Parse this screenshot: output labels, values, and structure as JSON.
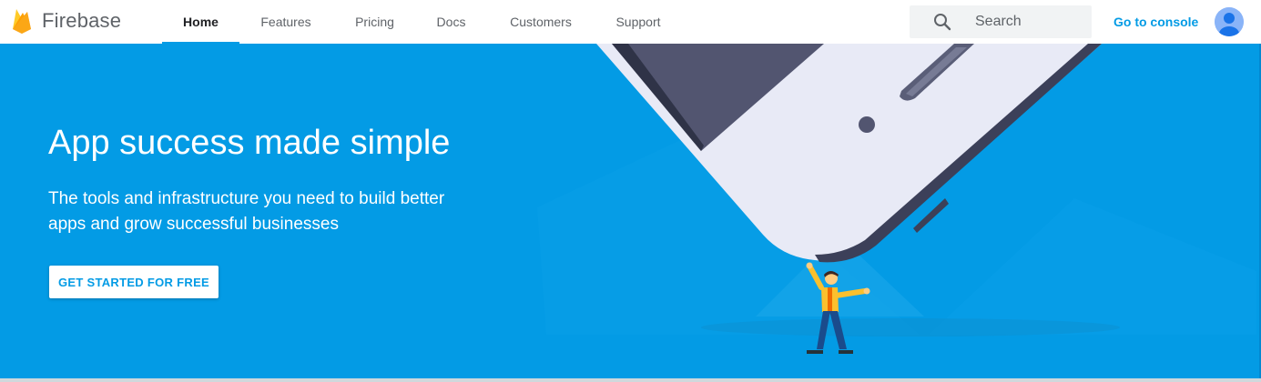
{
  "brand": {
    "name": "Firebase",
    "logo_icon": "firebase-flame-icon"
  },
  "nav": {
    "items": [
      {
        "label": "Home",
        "active": true
      },
      {
        "label": "Features",
        "active": false
      },
      {
        "label": "Pricing",
        "active": false
      },
      {
        "label": "Docs",
        "active": false
      },
      {
        "label": "Customers",
        "active": false
      },
      {
        "label": "Support",
        "active": false
      }
    ]
  },
  "search": {
    "placeholder": "Search",
    "value": "",
    "icon": "search-icon"
  },
  "console_link": {
    "label": "Go to console"
  },
  "avatar": {
    "icon": "user-avatar-icon"
  },
  "hero": {
    "title": "App success made simple",
    "subtitle": "The tools and infrastructure you need to build better apps and grow successful businesses",
    "cta_label": "GET STARTED FOR FREE",
    "illustration": "person-holding-phone-illustration"
  },
  "colors": {
    "accent": "#039be5",
    "hero_bg": "#039be5",
    "nav_text": "#5f6368",
    "nav_active_text": "#202124",
    "logo_orange": "#ffa000",
    "logo_yellow": "#ffca28"
  }
}
